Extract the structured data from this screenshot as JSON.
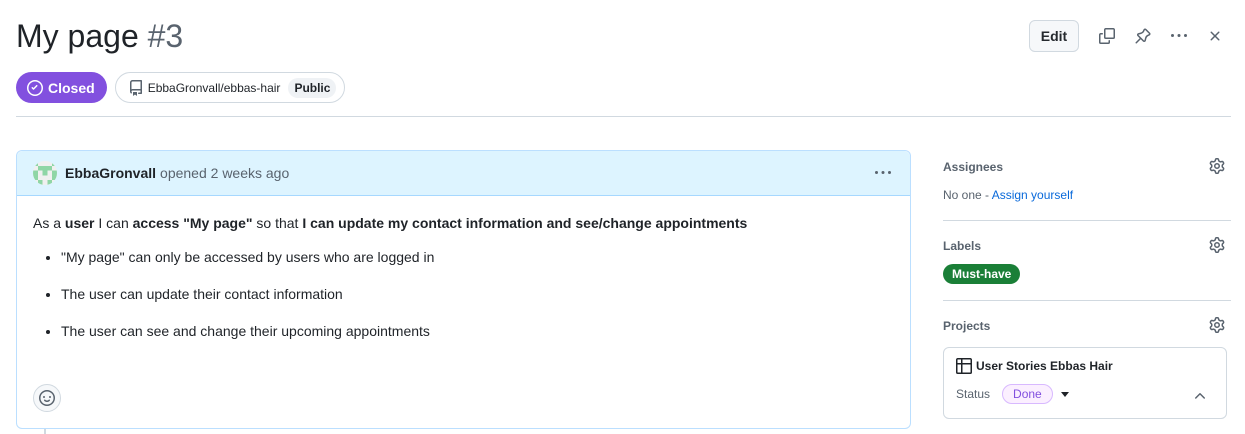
{
  "issue": {
    "title": "My page",
    "number": "#3",
    "state": "Closed",
    "repo": "EbbaGronvall/ebbas-hair",
    "visibility": "Public"
  },
  "toolbar": {
    "edit_label": "Edit",
    "icons": [
      "copy-icon",
      "pin-icon",
      "kebab-horizontal-icon",
      "close-icon"
    ]
  },
  "comment": {
    "author": "EbbaGronvall",
    "opened_text": "opened 2 weeks ago",
    "story": {
      "p1": "As a ",
      "role": "user",
      "p2": " I can ",
      "action": "access \"My page\"",
      "p3": " so that ",
      "benefit": "I can update my contact information and see/change appointments"
    },
    "criteria": [
      "\"My page\" can only be accessed by users who are logged in",
      "The user can update their contact information",
      "The user can see and change their upcoming appointments"
    ]
  },
  "sidebar": {
    "assignees": {
      "title": "Assignees",
      "none_text": "No one - ",
      "assign_link": "Assign yourself"
    },
    "labels": {
      "title": "Labels",
      "items": [
        {
          "name": "Must-have",
          "color": "#1a7f37"
        }
      ]
    },
    "projects": {
      "title": "Projects",
      "project_name": "User Stories Ebbas Hair",
      "status_label": "Status",
      "status_value": "Done"
    }
  },
  "colors": {
    "closed_badge": "#8250df",
    "comment_header": "#ddf4ff",
    "link": "#0969da",
    "status_done": "#8250df"
  }
}
